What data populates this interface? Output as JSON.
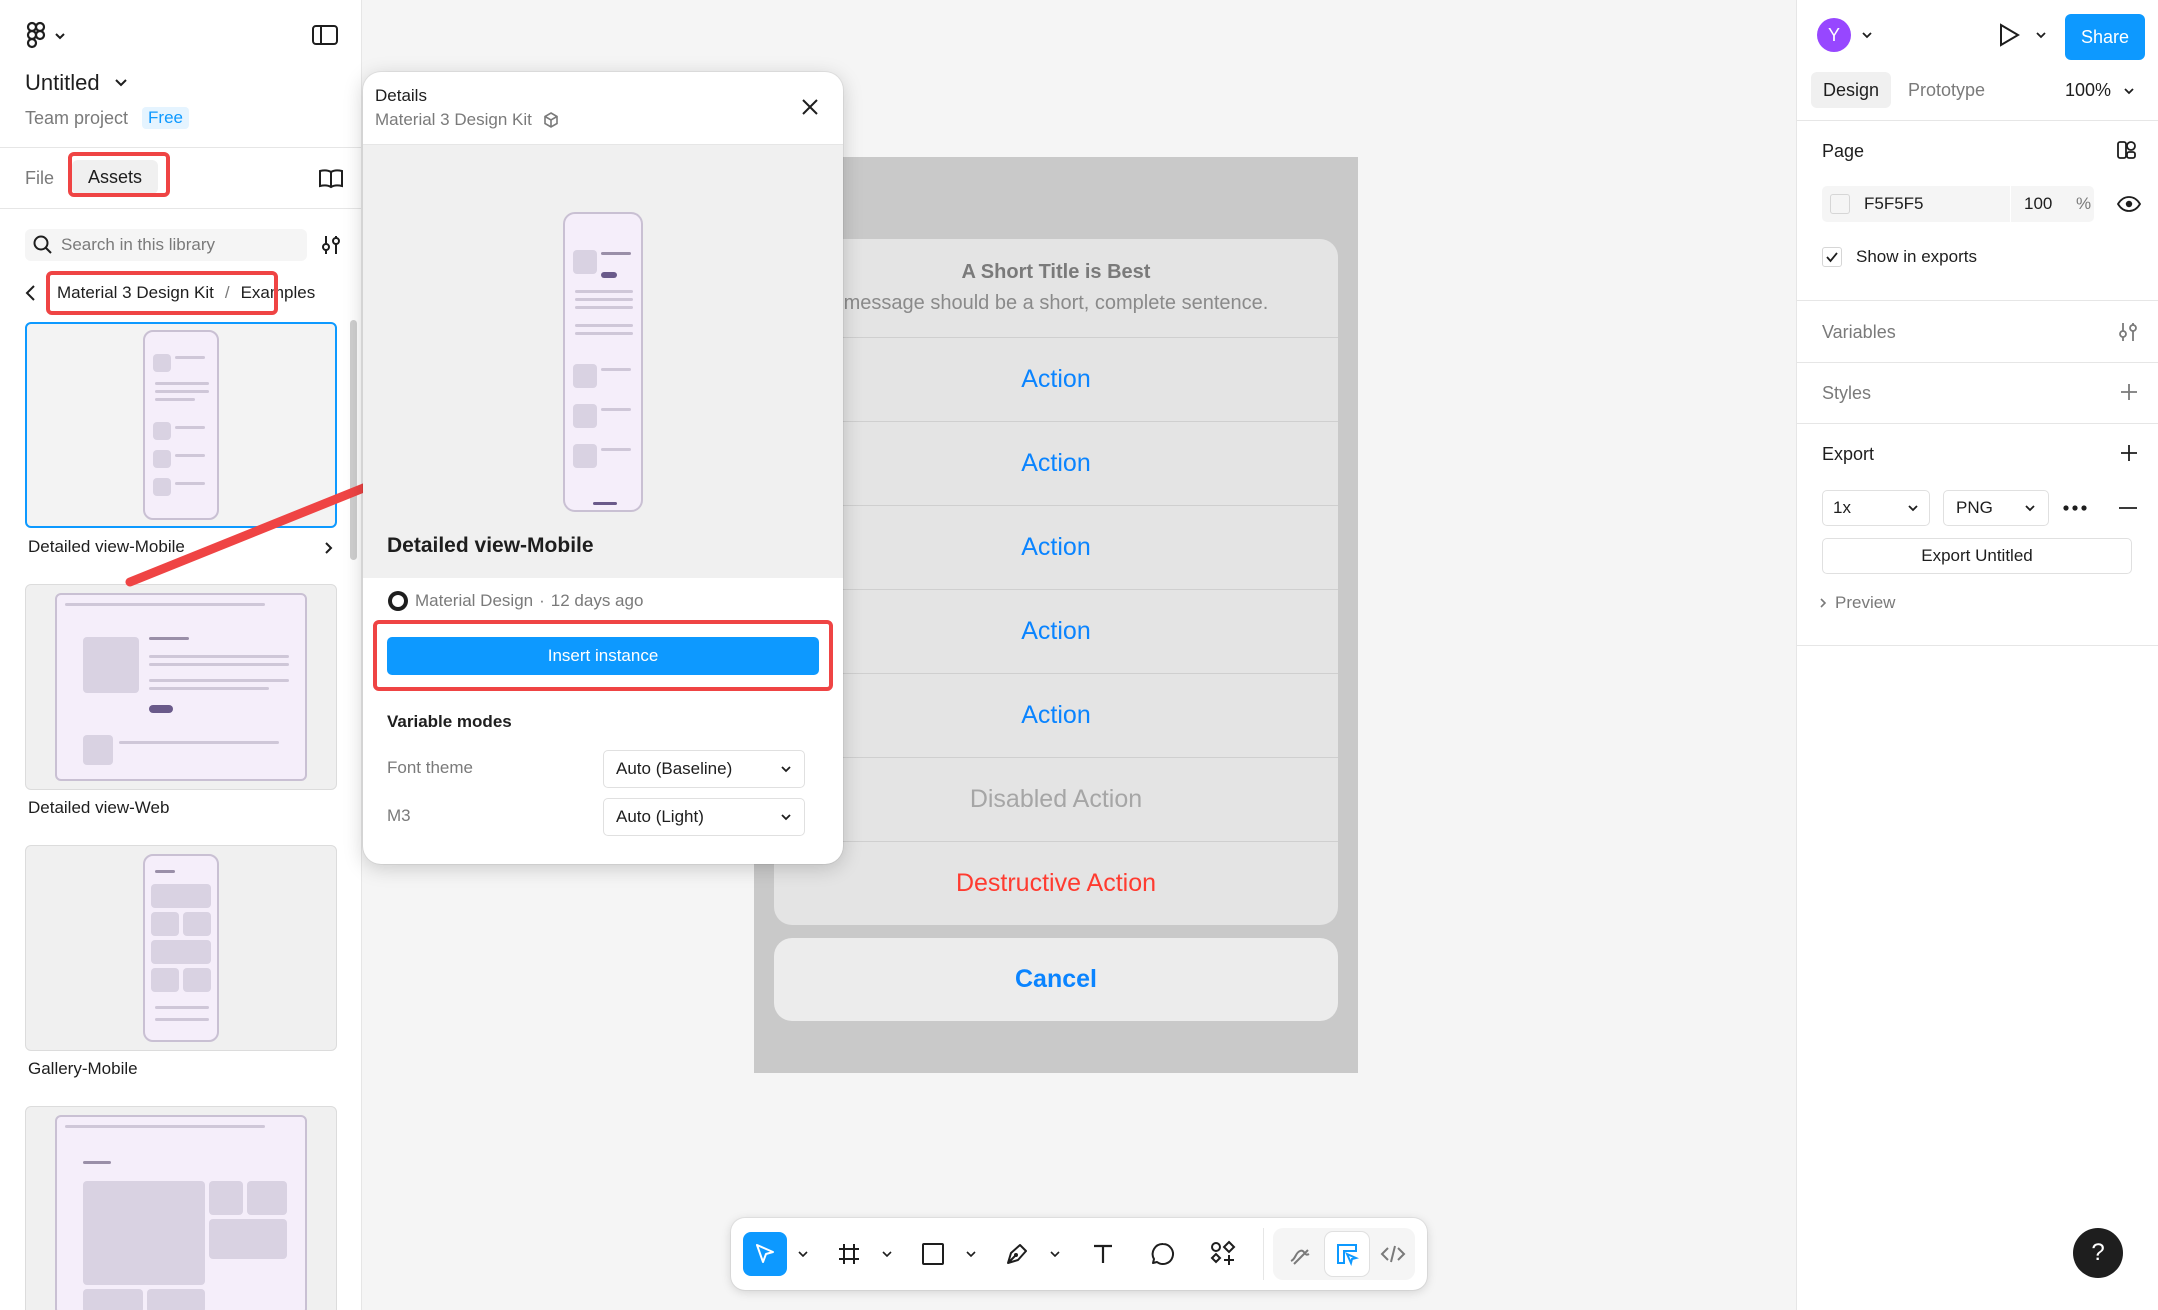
{
  "left_panel": {
    "file_name": "Untitled",
    "project": "Team project",
    "plan_badge": "Free",
    "tabs": [
      "File",
      "Assets"
    ],
    "search_placeholder": "Search in this library",
    "breadcrumb": {
      "library": "Material 3 Design Kit",
      "separator": "/",
      "page": "Examples"
    },
    "assets": [
      {
        "label": "Detailed view-Mobile"
      },
      {
        "label": "Detailed view-Web"
      },
      {
        "label": "Gallery-Mobile"
      },
      {
        "label": ""
      }
    ]
  },
  "details_popup": {
    "header": "Details",
    "subheader": "Material 3 Design Kit",
    "component_name": "Detailed view-Mobile",
    "author": "Material Design",
    "separator": "·",
    "updated": "12 days ago",
    "insert_button": "Insert instance",
    "variable_modes_title": "Variable modes",
    "modes": [
      {
        "label": "Font theme",
        "value": "Auto (Baseline)"
      },
      {
        "label": "M3",
        "value": "Auto (Light)"
      }
    ]
  },
  "canvas": {
    "sheet_title": "A Short Title is Best",
    "sheet_message": "message should be a short, complete sentence.",
    "actions": [
      "Action",
      "Action",
      "Action",
      "Action",
      "Action"
    ],
    "disabled_action": "Disabled Action",
    "destructive_action": "Destructive Action",
    "cancel": "Cancel"
  },
  "right_panel": {
    "avatar_initial": "Y",
    "share_button": "Share",
    "tabs": [
      "Design",
      "Prototype"
    ],
    "zoom": "100%",
    "page_section": "Page",
    "page_color": "F5F5F5",
    "page_opacity": "100",
    "percent_sign": "%",
    "show_in_exports": "Show in exports",
    "variables": "Variables",
    "styles": "Styles",
    "export": "Export",
    "export_scale": "1x",
    "export_format": "PNG",
    "export_button": "Export Untitled",
    "preview": "Preview"
  },
  "help_label": "?",
  "colors": {
    "accent": "#0d99ff",
    "highlight": "#ef4444",
    "ios_blue": "#0a84ff",
    "destructive": "#ff3b30"
  }
}
